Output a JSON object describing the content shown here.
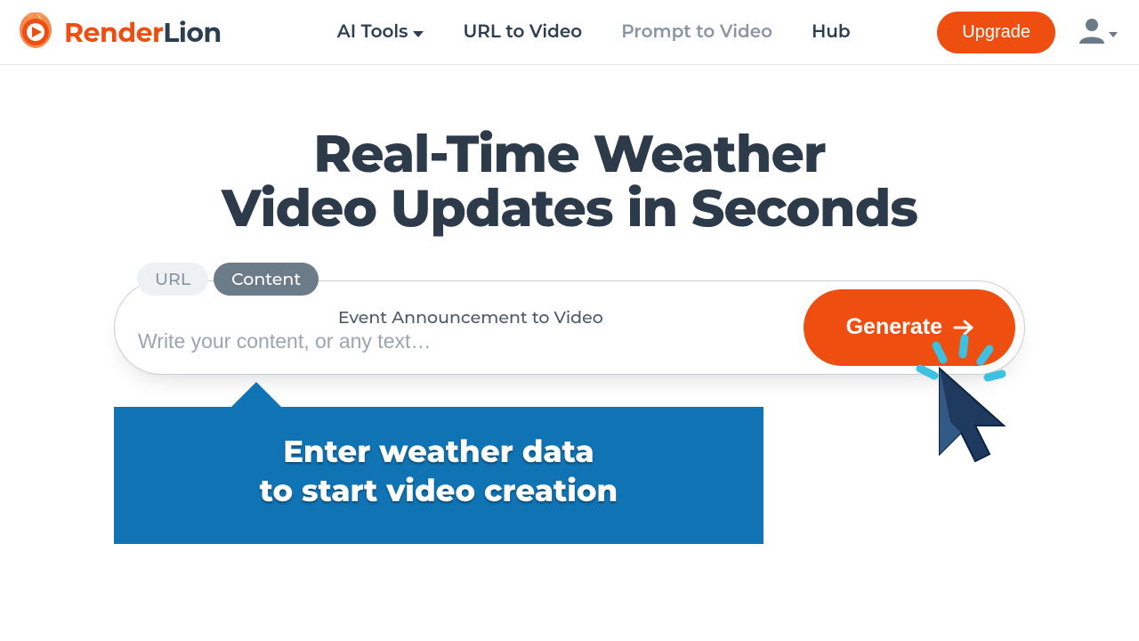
{
  "brand": {
    "name_a": "Render",
    "name_b": "Lion"
  },
  "nav": {
    "ai_tools": "AI Tools",
    "url_to_video": "URL to Video",
    "prompt_to_video": "Prompt to Video",
    "hub": "Hub"
  },
  "header": {
    "upgrade": "Upgrade"
  },
  "hero": {
    "line1": "Real-Time Weather",
    "line2": "Video Updates in Seconds"
  },
  "tabs": {
    "url": "URL",
    "content": "Content"
  },
  "prompt": {
    "label": "Event Announcement to Video",
    "placeholder": "Write your content, or any text…",
    "generate": "Generate"
  },
  "callout": {
    "line1": "Enter weather data",
    "line2": "to start video creation"
  },
  "colors": {
    "accent": "#ee4e10",
    "callout": "#0f73b4",
    "text": "#2c3e50"
  }
}
